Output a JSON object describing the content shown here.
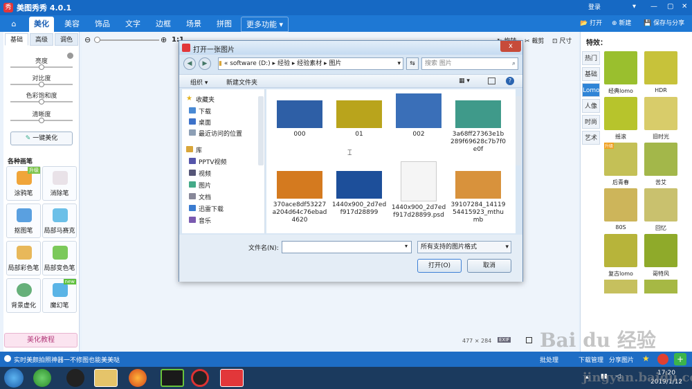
{
  "app": {
    "title": "美图秀秀 4.0.1",
    "logo": "秀",
    "login": "登录",
    "open": "打开",
    "new": "新建",
    "save_share": "保存与分享"
  },
  "nav": {
    "tabs": [
      "美化",
      "美容",
      "饰品",
      "文字",
      "边框",
      "场景",
      "拼图",
      "更多功能"
    ],
    "active": "美化"
  },
  "left": {
    "subtabs": [
      "基础",
      "高级",
      "调色"
    ],
    "sliders": [
      {
        "label": "亮度",
        "value": 0.5
      },
      {
        "label": "对比度",
        "value": 0.5
      },
      {
        "label": "色彩饱和度",
        "value": 0.5
      },
      {
        "label": "清晰度",
        "value": 0.5
      }
    ],
    "one_click": "一键美化",
    "brush_title": "各种画笔",
    "brushes": [
      "涂鸦笔",
      "消除笔",
      "抠图笔",
      "局部马赛克",
      "局部彩色笔",
      "局部变色笔",
      "背景虚化",
      "魔幻笔"
    ],
    "badges": [
      "升级",
      "new"
    ],
    "tutorial": "美化教程"
  },
  "canvas": {
    "zoom_label": "1:1",
    "dims": "477 × 284",
    "exif": "EXIF",
    "rotate": "旋转",
    "crop": "裁剪",
    "size": "尺寸"
  },
  "right": {
    "title": "特效：",
    "tabs": [
      "热门",
      "基础",
      "Lomo",
      "人像",
      "时尚",
      "艺术"
    ],
    "active_tab": "Lomo",
    "effects": [
      "经典lomo",
      "HDR",
      "摇滚",
      "旧时光",
      "后青春",
      "苦艾",
      "80S",
      "回忆",
      "复古lomo",
      "哥特风"
    ],
    "lock_badge": "升级"
  },
  "dialog": {
    "title": "打开一张图片",
    "close": "x",
    "path": [
      "software (D:)",
      "经验",
      "经验素材",
      "图片"
    ],
    "search_placeholder": "搜索 图片",
    "organize": "组织",
    "new_folder": "新建文件夹",
    "nav_groups": [
      {
        "name": "收藏夹",
        "items": [
          "下载",
          "桌面",
          "最近访问的位置"
        ]
      },
      {
        "name": "库",
        "items": [
          "PPTV视频",
          "视频",
          "图片",
          "文档",
          "迅雷下载",
          "音乐"
        ]
      }
    ],
    "files": [
      {
        "name": "000",
        "color": "#2e5fa6"
      },
      {
        "name": "01",
        "color": "#b9a41c"
      },
      {
        "name": "002",
        "color": "#3a6fb8"
      },
      {
        "name": "3a68ff27363e1b289f69628c7b7f0e0f",
        "color": "#3f9a8a"
      },
      {
        "name": "370ace8df53227a204d64c76ebad4620",
        "color": "#d47a1f"
      },
      {
        "name": "1440x900_2d7edf917d28899",
        "color": "#1d4f9a"
      },
      {
        "name": "1440x900_2d7edf917d28899.psd",
        "color": "#f5f5f5"
      },
      {
        "name": "39107284_1411954415923_mthumb",
        "color": "#d8923c"
      }
    ],
    "filename_label": "文件名(N):",
    "filename_value": "",
    "filetype": "所有支持的图片格式",
    "open_btn": "打开(O)",
    "cancel_btn": "取消"
  },
  "status": {
    "message": "实时美颜拍照神器一不修图也能美美哒",
    "batch": "批处理",
    "download_mgr": "下载管理",
    "share_pic": "分享图片"
  },
  "taskbar": {
    "time": "17:20",
    "date": "2019/1/12"
  },
  "watermark": {
    "text": "Bai du 经验",
    "url": "jingyan.baidu.com"
  }
}
